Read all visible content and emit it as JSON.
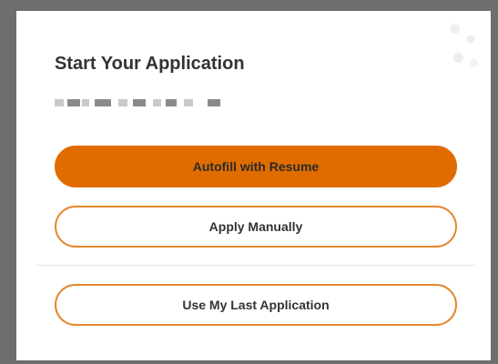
{
  "dialog": {
    "title": "Start Your Application"
  },
  "actions": {
    "autofill_label": "Autofill with Resume",
    "manual_label": "Apply Manually",
    "last_application_label": "Use My Last Application"
  },
  "colors": {
    "primary_orange": "#e06c00",
    "outline_orange": "#e3872e",
    "text_dark": "#333333"
  }
}
